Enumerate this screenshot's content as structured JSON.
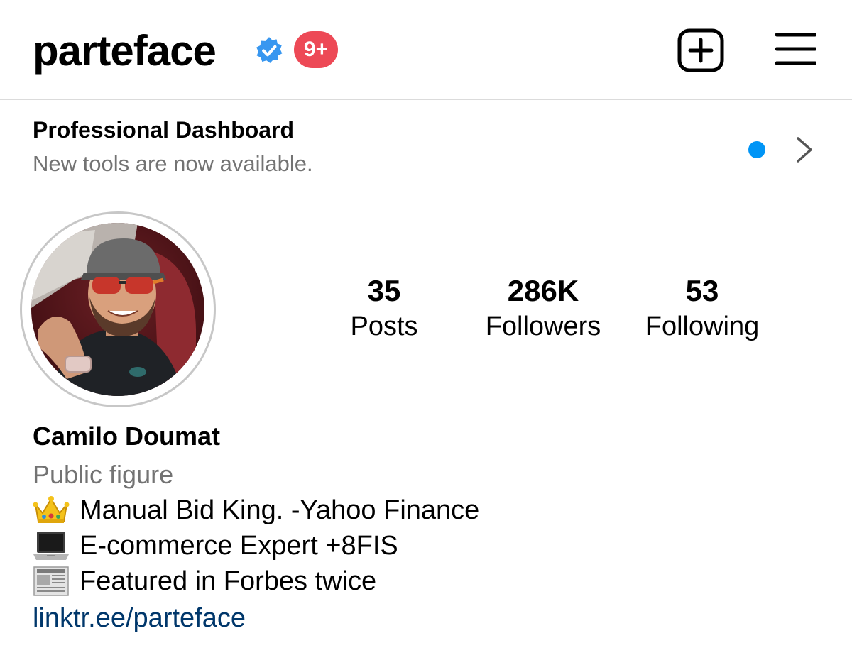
{
  "header": {
    "username": "parteface",
    "notification_badge": "9+",
    "verified_icon": "verified-badge-icon",
    "new_post_icon": "plus-square-icon",
    "menu_icon": "hamburger-menu-icon"
  },
  "dashboard": {
    "title": "Professional Dashboard",
    "subtitle": "New tools are now available.",
    "indicator_icon": "blue-dot-icon",
    "chevron_icon": "chevron-right-icon"
  },
  "stats": [
    {
      "value": "35",
      "label": "Posts"
    },
    {
      "value": "286K",
      "label": "Followers"
    },
    {
      "value": "53",
      "label": "Following"
    }
  ],
  "profile": {
    "full_name": "Camilo Doumat",
    "category": "Public figure",
    "bio": [
      {
        "icon": "crown-icon",
        "text": "Manual Bid King. -Yahoo Finance"
      },
      {
        "icon": "laptop-icon",
        "text": "E-commerce Expert +8FIS"
      },
      {
        "icon": "newspaper-icon",
        "text": "Featured in Forbes twice"
      }
    ],
    "link": "linktr.ee/parteface"
  },
  "colors": {
    "verified_blue": "#3897f0",
    "badge_red": "#ed4956",
    "dot_blue": "#0095f6",
    "secondary_text": "#737373",
    "link": "#00376b",
    "divider": "#dbdbdb"
  }
}
